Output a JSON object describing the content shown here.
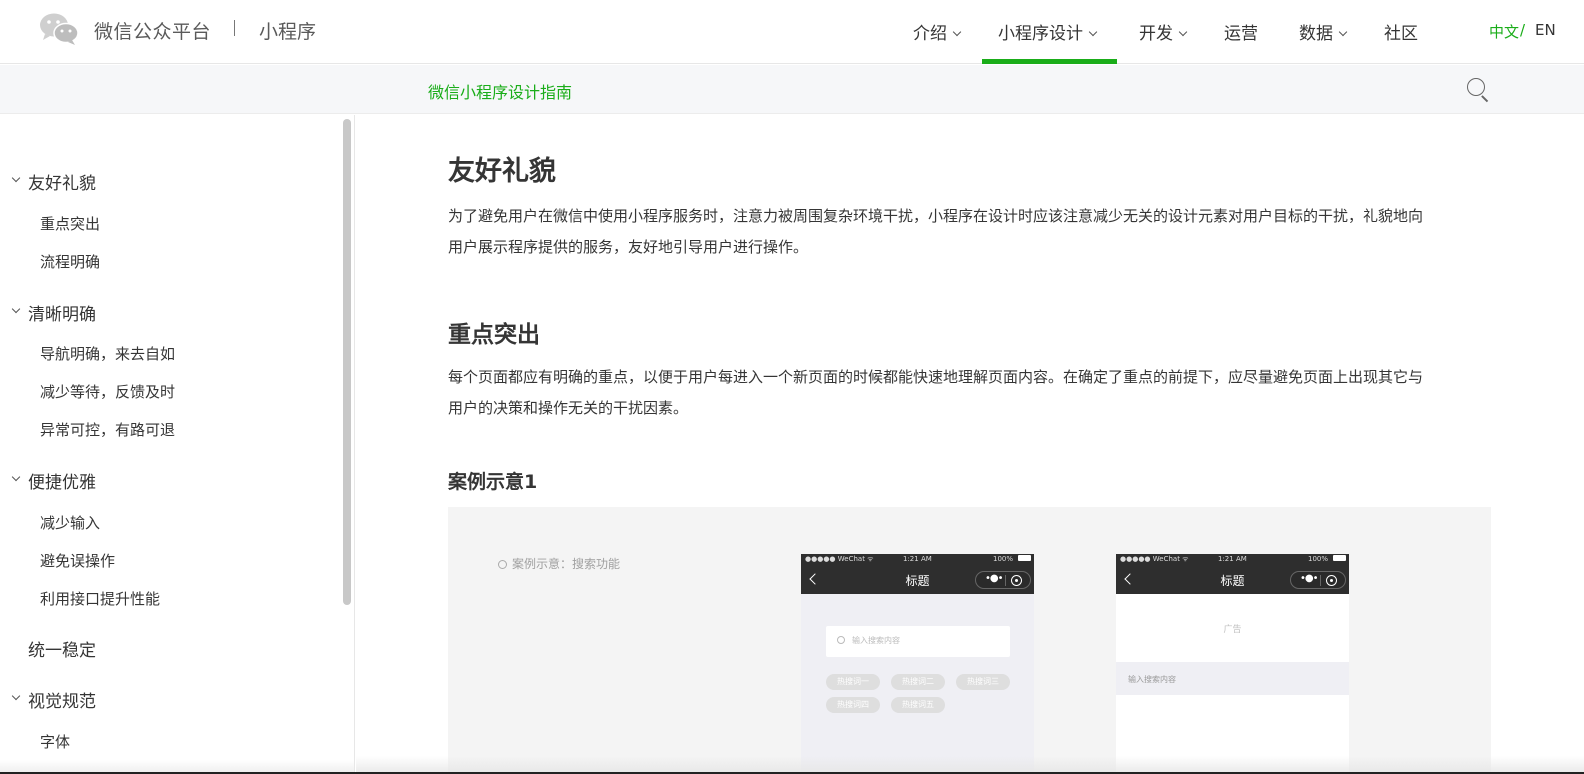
{
  "header": {
    "brand": "微信公众平台",
    "brand_sub": "小程序",
    "nav": [
      {
        "label": "介绍"
      },
      {
        "label": "小程序设计"
      },
      {
        "label": "开发"
      },
      {
        "label": "运营"
      },
      {
        "label": "数据"
      },
      {
        "label": "社区"
      }
    ],
    "active_nav": "小程序设计",
    "lang_cn": "中文",
    "lang_sep": "/",
    "lang_en": "EN"
  },
  "subheader": {
    "title": "微信小程序设计指南",
    "search_icon": "search-icon"
  },
  "sidebar": {
    "groups": [
      {
        "label": "友好礼貌",
        "items": [
          "重点突出",
          "流程明确"
        ]
      },
      {
        "label": "清晰明确",
        "items": [
          "导航明确，来去自如",
          "减少等待，反馈及时",
          "异常可控，有路可退"
        ]
      },
      {
        "label": "便捷优雅",
        "items": [
          "减少输入",
          "避免误操作",
          "利用接口提升性能"
        ]
      },
      {
        "label": "统一稳定",
        "items": []
      },
      {
        "label": "视觉规范",
        "items": [
          "字体"
        ]
      }
    ]
  },
  "content": {
    "h1": "友好礼貌",
    "p1_line1": "为了避免用户在微信中使用小程序服务时，注意力被周围复杂环境干扰，小程序在设计时应该注意减少无关的设计元素对用户目标的干扰，礼貌地向",
    "p1_line2": "用户展示程序提供的服务，友好地引导用户进行操作。",
    "h2": "重点突出",
    "p2_line1": "每个页面都应有明确的重点，以便于用户每进入一个新页面的时候都能快速地理解页面内容。在确定了重点的前提下，应尽量避免页面上出现其它与",
    "p2_line2": "用户的决策和操作无关的干扰因素。",
    "h3": "案例示意1",
    "example": {
      "caption": "案例示意：搜索功能",
      "phone": {
        "carrier": "●●●●● WeChat ᯤ",
        "time": "1:21 AM",
        "battery": "100%",
        "title": "标题",
        "capsule_dots": "•●•"
      },
      "phone_a": {
        "search_placeholder": "输入搜索内容",
        "tags": [
          "热搜词一",
          "热搜词二",
          "热搜词三",
          "热搜词四",
          "热搜词五"
        ]
      },
      "phone_b": {
        "ad": "广告",
        "search_placeholder": "输入搜索内容"
      }
    }
  },
  "colors": {
    "accent": "#1aad19",
    "text": "#353535",
    "phone_bar": "#2e2e2e"
  }
}
